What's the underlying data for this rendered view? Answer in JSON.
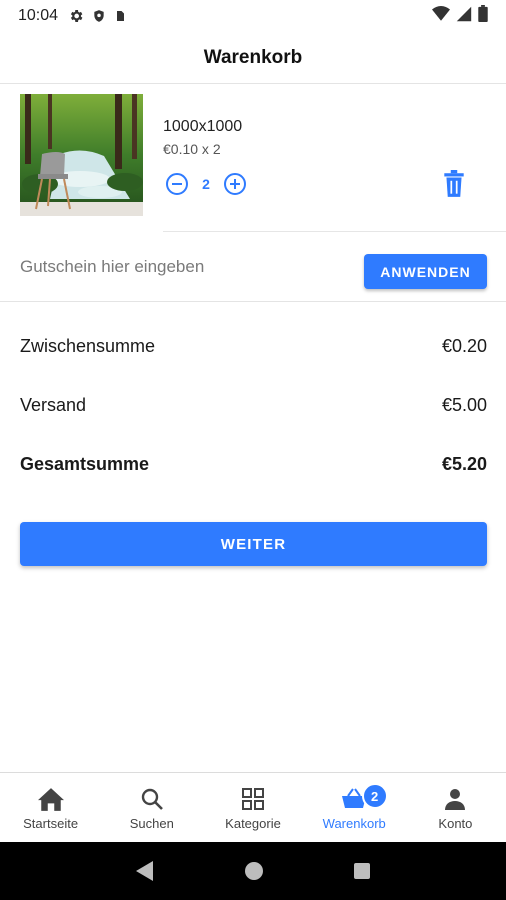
{
  "status_bar": {
    "time": "10:04"
  },
  "app_bar": {
    "title": "Warenkorb"
  },
  "cart": {
    "items": [
      {
        "name": "1000x1000",
        "price_line": "€0.10 x 2",
        "quantity": "2"
      }
    ]
  },
  "coupon": {
    "placeholder": "Gutschein hier eingeben",
    "apply_label": "ANWENDEN"
  },
  "summary": {
    "subtotal_label": "Zwischensumme",
    "subtotal_value": "€0.20",
    "shipping_label": "Versand",
    "shipping_value": "€5.00",
    "total_label": "Gesamtsumme",
    "total_value": "€5.20"
  },
  "actions": {
    "continue_label": "WEITER"
  },
  "bottom_nav": {
    "items": [
      {
        "label": "Startseite",
        "icon": "home-icon"
      },
      {
        "label": "Suchen",
        "icon": "search-icon"
      },
      {
        "label": "Kategorie",
        "icon": "grid-icon"
      },
      {
        "label": "Warenkorb",
        "icon": "basket-icon",
        "badge": "2",
        "active": true
      },
      {
        "label": "Konto",
        "icon": "person-icon"
      }
    ]
  },
  "colors": {
    "accent": "#2f7bff",
    "text": "#212121",
    "divider": "#e4e4e4"
  }
}
